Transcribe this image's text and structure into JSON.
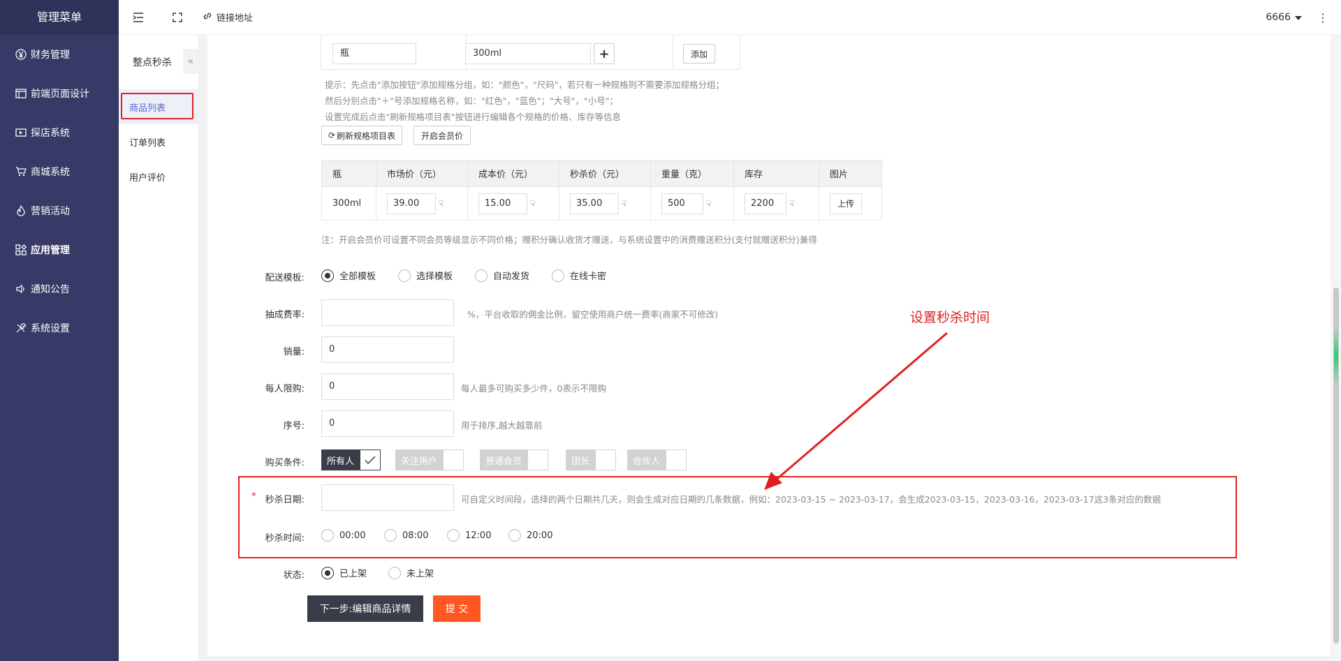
{
  "sidebar": {
    "brand": "管理菜单",
    "items": [
      {
        "icon": "yen-icon",
        "label": "财务管理"
      },
      {
        "icon": "layout-icon",
        "label": "前端页面设计"
      },
      {
        "icon": "video-icon",
        "label": "探店系统"
      },
      {
        "icon": "cart-icon",
        "label": "商城系统"
      },
      {
        "icon": "fire-icon",
        "label": "营销活动"
      },
      {
        "icon": "apps-icon",
        "label": "应用管理"
      },
      {
        "icon": "speaker-icon",
        "label": "通知公告"
      },
      {
        "icon": "tools-icon",
        "label": "系统设置"
      }
    ]
  },
  "topbar": {
    "link_label": "链接地址",
    "user": "6666"
  },
  "subnav": {
    "title": "整点秒杀",
    "items": [
      {
        "label": "商品列表"
      },
      {
        "label": "订单列表"
      },
      {
        "label": "用户评价"
      }
    ]
  },
  "spec_group": {
    "name_value": "瓶",
    "item_value": "300ml",
    "add_label": "添加"
  },
  "spec_hints": [
    "提示：先点击\"添加按钮\"添加规格分组，如：\"颜色\"，\"尺码\"，若只有一种规格则不需要添加规格分组；",
    "然后分别点击\"＋\"号添加规格名称，如：\"红色\"，\"蓝色\"；\"大号\"，\"小号\"；",
    "设置完成后点击\"刷新规格项目表\"按钮进行编辑各个规格的价格、库存等信息"
  ],
  "buttons": {
    "refresh": "刷新规格项目表",
    "member_price": "开启会员价"
  },
  "spec_table": {
    "headers": [
      "瓶",
      "市场价（元）",
      "成本价（元）",
      "秒杀价（元）",
      "重量（克）",
      "库存",
      "图片"
    ],
    "row": {
      "name": "300ml",
      "market": "39.00",
      "cost": "15.00",
      "seckill": "35.00",
      "weight": "500",
      "stock": "2200",
      "upload": "上传"
    }
  },
  "spec_note": "注：开启会员价可设置不同会员等级显示不同价格；赠积分确认收货才赠送，与系统设置中的消费赠送积分(支付就赠送积分)兼得",
  "form": {
    "delivery": {
      "label": "配送模板:",
      "options": [
        "全部模板",
        "选择模板",
        "自动发货",
        "在线卡密"
      ],
      "selected": 0
    },
    "commission": {
      "label": "抽成费率:",
      "value": "",
      "hint": "%，平台收取的佣金比例，留空使用商户统一费率(商家不可修改)"
    },
    "sales": {
      "label": "销量:",
      "value": "0"
    },
    "limit": {
      "label": "每人限购:",
      "value": "0",
      "hint": "每人最多可购买多少件，0表示不限购"
    },
    "order": {
      "label": "序号:",
      "value": "0",
      "hint": "用于排序,越大越靠前"
    },
    "condition": {
      "label": "购买条件:",
      "options": [
        "所有人",
        "关注用户",
        "普通会员",
        "团长",
        "合伙人"
      ],
      "selected": 0
    },
    "seckill_date": {
      "required": "*",
      "label": "秒杀日期:",
      "value": "",
      "hint": "可自定义时间段，选择的两个日期共几天，则会生成对应日期的几条数据，例如：2023-03-15 ~ 2023-03-17，会生成2023-03-15，2023-03-16，2023-03-17这3条对应的数据"
    },
    "seckill_time": {
      "label": "秒杀时间:",
      "options": [
        "00:00",
        "08:00",
        "12:00",
        "20:00"
      ]
    },
    "status": {
      "label": "状态:",
      "options": [
        "已上架",
        "未上架"
      ],
      "selected": 0
    }
  },
  "actions": {
    "next": "下一步:编辑商品详情",
    "submit": "提 交"
  },
  "annotation": "设置秒杀时间",
  "colors": {
    "sidebar": "#373a66",
    "accent": "#ff5722",
    "dark_button": "#393d49",
    "annotation": "#e02020"
  }
}
